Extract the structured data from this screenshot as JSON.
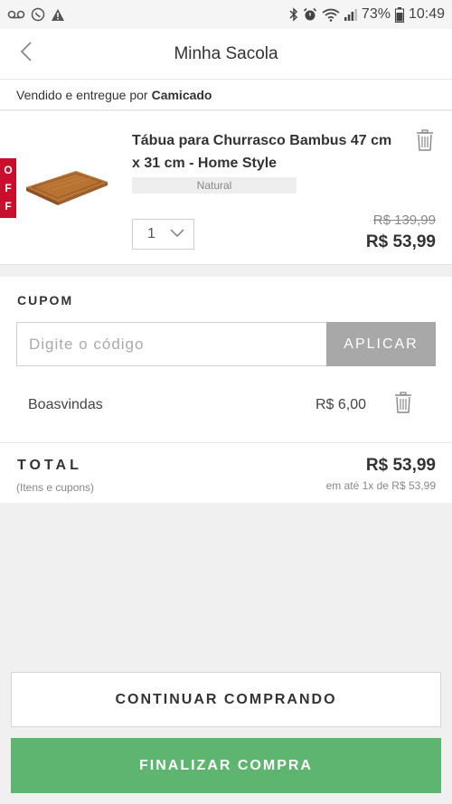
{
  "status_bar": {
    "battery": "73%",
    "time": "10:49",
    "left_icons": [
      "voicemail-icon",
      "whatsapp-icon",
      "warning-icon"
    ],
    "right_icons": [
      "bluetooth-icon",
      "alarm-icon",
      "wifi-icon",
      "signal-icon",
      "battery-icon"
    ]
  },
  "header": {
    "title": "Minha Sacola",
    "back_icon": "chevron-left-icon"
  },
  "seller": {
    "prefix": "Vendido e entregue por",
    "name": "Camicado"
  },
  "cart_item": {
    "badge_letters": [
      "O",
      "F",
      "F"
    ],
    "name": "Tábua para Churrasco Bambus 47 cm x 31 cm - Home Style",
    "variant": "Natural",
    "quantity": "1",
    "old_price": "R$ 139,99",
    "price": "R$ 53,99",
    "remove_icon": "trash-icon"
  },
  "coupon": {
    "label": "CUPOM",
    "input_placeholder": "Digite o código",
    "input_value": "",
    "apply_label": "APLICAR",
    "applied": {
      "code": "Boasvindas",
      "value": "R$ 6,00"
    }
  },
  "total": {
    "label": "TOTAL",
    "sublabel": "(Itens e cupons)",
    "value": "R$ 53,99",
    "installments": "em até 1x de R$ 53,99"
  },
  "actions": {
    "continue_label": "CONTINUAR COMPRANDO",
    "checkout_label": "FINALIZAR COMPRA"
  },
  "colors": {
    "accent_green": "#5db56f",
    "off_badge_red": "#c8102e",
    "apply_button_gray": "#a8a8a8"
  }
}
